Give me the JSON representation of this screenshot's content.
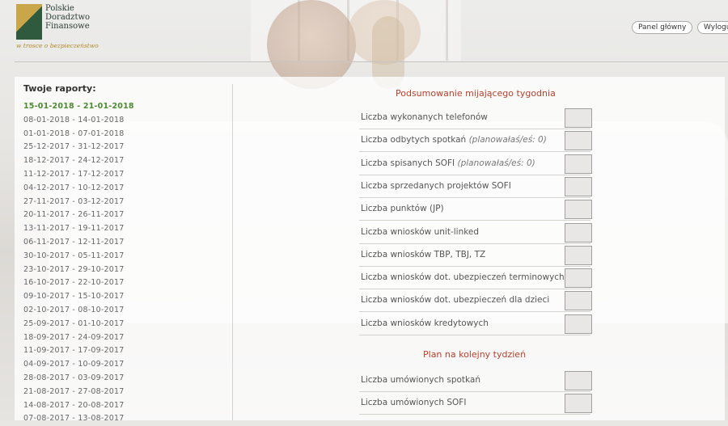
{
  "header": {
    "logo_lines": [
      "Polskie",
      "Doradztwo",
      "Finansowe"
    ],
    "tagline": "w trosce o bezpieczeństwo",
    "nav": {
      "home": "Panel główny",
      "logout": "Wylogu"
    }
  },
  "reports": {
    "title": "Twoje raporty:",
    "items": [
      "15-01-2018 - 21-01-2018",
      "08-01-2018 - 14-01-2018",
      "01-01-2018 - 07-01-2018",
      "25-12-2017 - 31-12-2017",
      "18-12-2017 - 24-12-2017",
      "11-12-2017 - 17-12-2017",
      "04-12-2017 - 10-12-2017",
      "27-11-2017 - 03-12-2017",
      "20-11-2017 - 26-11-2017",
      "13-11-2017 - 19-11-2017",
      "06-11-2017 - 12-11-2017",
      "30-10-2017 - 05-11-2017",
      "23-10-2017 - 29-10-2017",
      "16-10-2017 - 22-10-2017",
      "09-10-2017 - 15-10-2017",
      "02-10-2017 - 08-10-2017",
      "25-09-2017 - 01-10-2017",
      "18-09-2017 - 24-09-2017",
      "11-09-2017 - 17-09-2017",
      "04-09-2017 - 10-09-2017",
      "28-08-2017 - 03-09-2017",
      "21-08-2017 - 27-08-2017",
      "14-08-2017 - 20-08-2017",
      "07-08-2017 - 13-08-2017"
    ],
    "active_index": 0
  },
  "summary": {
    "title": "Podsumowanie mijającego tygodnia",
    "rows": [
      {
        "label": "Liczba wykonanych telefonów",
        "note": ""
      },
      {
        "label": "Liczba odbytych spotkań",
        "note": "(planowałaś/eś: 0)"
      },
      {
        "label": "Liczba spisanych SOFI",
        "note": "(planowałaś/eś: 0)"
      },
      {
        "label": "Liczba sprzedanych projektów SOFI",
        "note": ""
      },
      {
        "label": "Liczba punktów (JP)",
        "note": ""
      },
      {
        "label": "Liczba wniosków unit-linked",
        "note": ""
      },
      {
        "label": "Liczba wniosków TBP, TBJ, TZ",
        "note": ""
      },
      {
        "label": "Liczba wniosków dot. ubezpieczeń terminowych",
        "note": ""
      },
      {
        "label": "Liczba wniosków dot. ubezpieczeń dla dzieci",
        "note": ""
      },
      {
        "label": "Liczba wniosków kredytowych",
        "note": ""
      }
    ]
  },
  "plan": {
    "title": "Plan na kolejny tydzień",
    "rows": [
      {
        "label": "Liczba umówionych spotkań",
        "note": ""
      },
      {
        "label": "Liczba umówionych SOFI",
        "note": ""
      }
    ]
  }
}
